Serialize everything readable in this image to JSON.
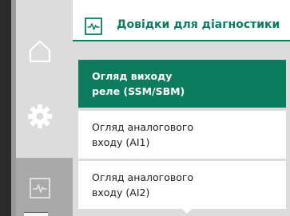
{
  "header": {
    "title": "Довідки для діагностики",
    "icon": "diagnostics-pulse-icon"
  },
  "nav": {
    "items": [
      {
        "id": "home",
        "icon": "home-icon"
      },
      {
        "id": "settings",
        "icon": "gear-icon"
      },
      {
        "id": "diagnostics",
        "icon": "diagnostics-pulse-icon",
        "active": true
      }
    ]
  },
  "menu": {
    "items": [
      {
        "line1": "Огляд виходу",
        "line2": "реле (SSM/SBM)",
        "selected": true
      },
      {
        "line1": "Огляд аналогового",
        "line2": "входу (AI1)",
        "selected": false
      },
      {
        "line1": "Огляд аналогового",
        "line2": "входу (AI2)",
        "selected": false
      }
    ]
  },
  "colors": {
    "accent": "#0d7b5e",
    "rail": "#d5d5d5",
    "rail_active": "#a9a9a9",
    "background": "#dcdcdc"
  }
}
